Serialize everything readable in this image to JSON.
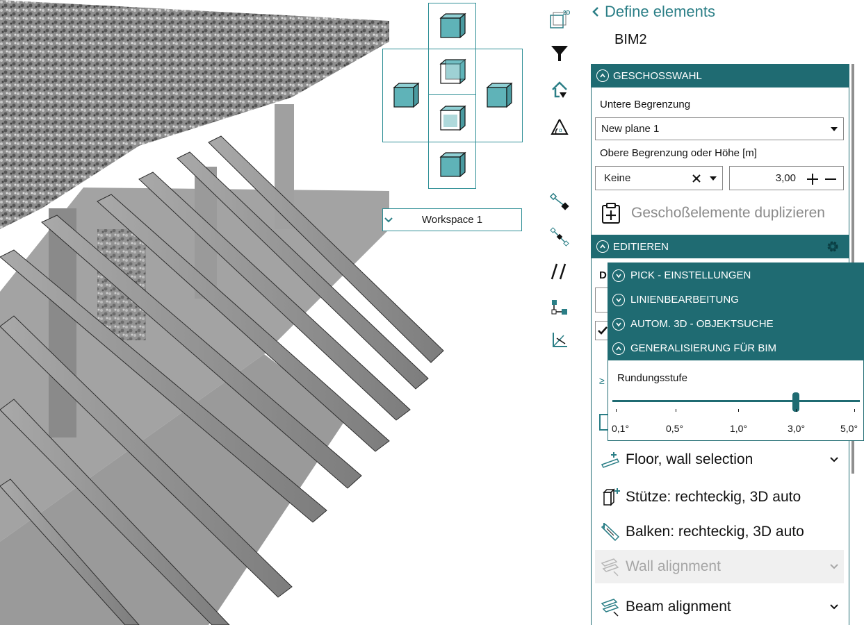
{
  "viewport": {
    "workspace_select": "Workspace 1",
    "viewcube_faces": [
      "top-face",
      "back-face",
      "left-face",
      "front-face",
      "right-face",
      "bottom-face"
    ]
  },
  "toolstrip": {
    "icons": [
      "2d-view-icon",
      "filter-icon",
      "house-arrow-icon",
      "angle-measure-icon",
      "pick-point-icon",
      "pick-line-icon",
      "parallel-lines-icon",
      "hierarchy-icon",
      "axis-icon"
    ],
    "tool_2d_label": "2D"
  },
  "header": {
    "back_label": "Define elements",
    "subtitle": "BIM2"
  },
  "geschosswahl": {
    "title": "GESCHOSSWAHL",
    "lower_label": "Untere Begrenzung",
    "lower_value": "New plane 1",
    "upper_label": "Obere Begrenzung oder Höhe [m]",
    "upper_value": "Keine",
    "height_value": "3,00",
    "duplicate_label": "Geschoßelemente duplizieren"
  },
  "editieren": {
    "title": "EDITIEREN",
    "partial_label": "D"
  },
  "popup": {
    "rows": [
      {
        "label": "PICK - EINSTELLUNGEN",
        "state": "collapsed"
      },
      {
        "label": "LINIENBEARBEITUNG",
        "state": "collapsed"
      },
      {
        "label": "AUTOM. 3D - OBJEKTSUCHE",
        "state": "collapsed"
      },
      {
        "label": "GENERALISIERUNG FÜR BIM",
        "state": "expanded"
      }
    ],
    "slider_label": "Rundungsstufe",
    "slider_ticks": [
      "0,1°",
      "0,5°",
      "1,0°",
      "3,0°",
      "5,0°"
    ],
    "slider_value": "3,0°"
  },
  "elements": [
    {
      "label": "Floor, wall selection",
      "icon": "floor-wall-icon",
      "chevron": true,
      "disabled": false
    },
    {
      "label": "Stütze: rechteckig, 3D auto",
      "icon": "column-icon",
      "chevron": false,
      "disabled": false
    },
    {
      "label": "Balken: rechteckig, 3D auto",
      "icon": "beam-icon",
      "chevron": false,
      "disabled": false
    },
    {
      "label": "Wall alignment",
      "icon": "wall-align-icon",
      "chevron": true,
      "disabled": true
    },
    {
      "label": "Beam alignment",
      "icon": "beam-align-icon",
      "chevron": true,
      "disabled": false
    }
  ],
  "colors": {
    "accent": "#1f6b72",
    "accent_light": "#2f8f96",
    "cube_fill": "#5fb3b8"
  }
}
